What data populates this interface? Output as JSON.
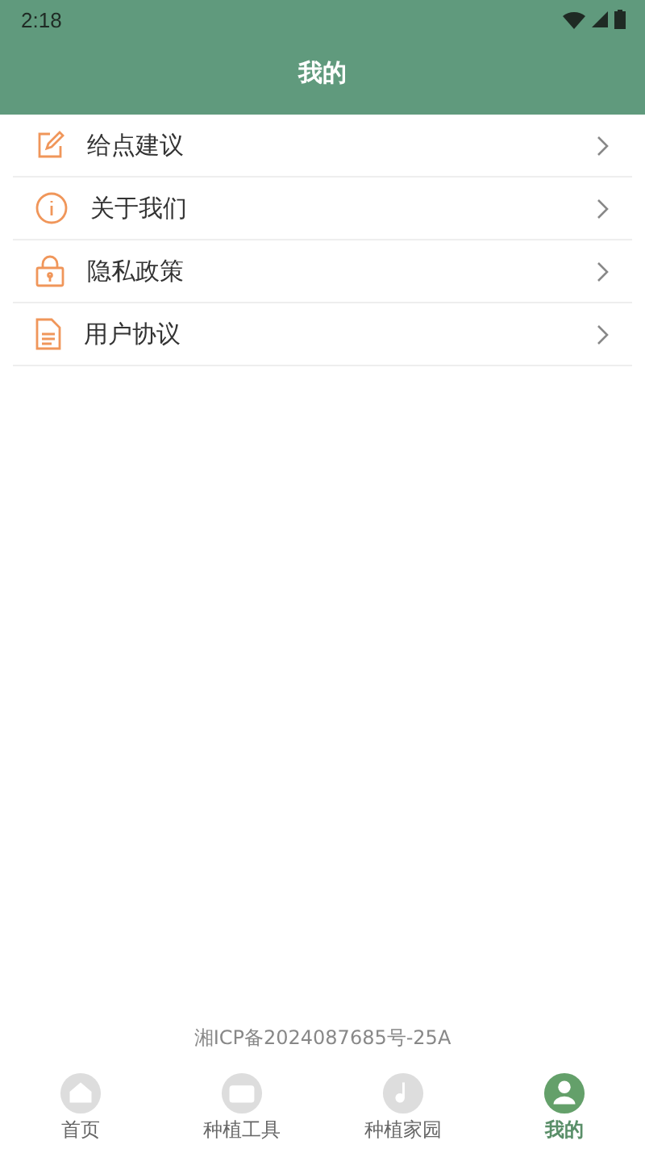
{
  "status_bar": {
    "time": "2:18"
  },
  "header": {
    "title": "我的"
  },
  "menu": [
    {
      "label": "给点建议"
    },
    {
      "label": "关于我们"
    },
    {
      "label": "隐私政策"
    },
    {
      "label": "用户协议"
    }
  ],
  "footer": {
    "record": "湘ICP备2024087685号-25A"
  },
  "tabs": [
    {
      "label": "首页",
      "selected": false
    },
    {
      "label": "种植工具",
      "selected": false
    },
    {
      "label": "种植家园",
      "selected": false
    },
    {
      "label": "我的",
      "selected": true
    }
  ]
}
